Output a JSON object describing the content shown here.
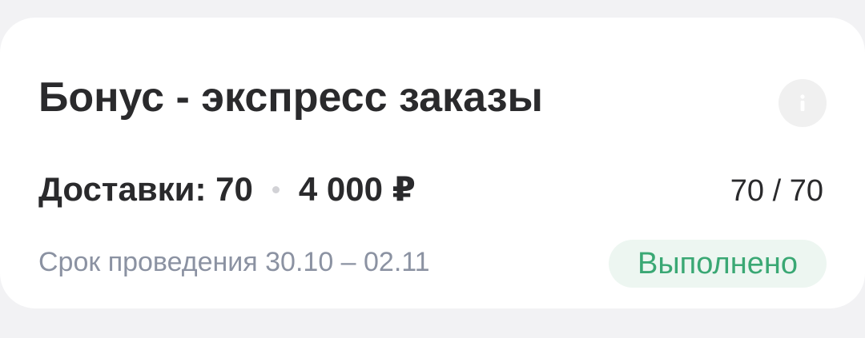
{
  "bonus": {
    "title": "Бонус - экспресс заказы",
    "info_icon": "info-icon",
    "deliveries_label": "Доставки: 70",
    "amount": "4 000 ₽",
    "progress": "70 / 70",
    "period": "Срок проведения 30.10 – 02.11",
    "status": "Выполнено"
  },
  "colors": {
    "title_text": "#2a2a2c",
    "muted_text": "#8b92a2",
    "status_green": "#3aa874",
    "status_bg": "#edf6f1",
    "info_bg": "#f0f0f0",
    "page_bg": "#f2f2f4",
    "card_bg": "#ffffff"
  }
}
